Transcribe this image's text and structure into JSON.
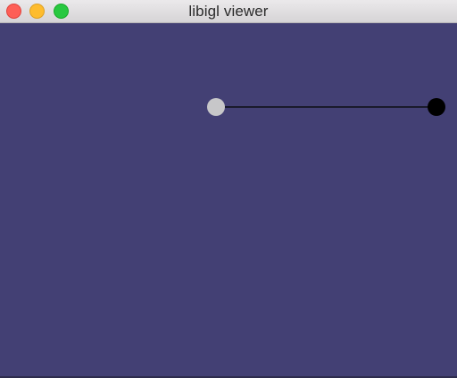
{
  "window": {
    "title": "libigl viewer"
  },
  "titlebar": {
    "buttons": [
      {
        "name": "close-button",
        "color": "#fe5f57",
        "border": "#e0443e"
      },
      {
        "name": "minimize-button",
        "color": "#febc2e",
        "border": "#dea123"
      },
      {
        "name": "zoom-button",
        "color": "#28c840",
        "border": "#1aab29"
      }
    ]
  },
  "scene": {
    "background_color": "#434074",
    "edge_color": "#0d0d14",
    "start_point_color": "#c7c7c9",
    "end_point_color": "#000000"
  }
}
